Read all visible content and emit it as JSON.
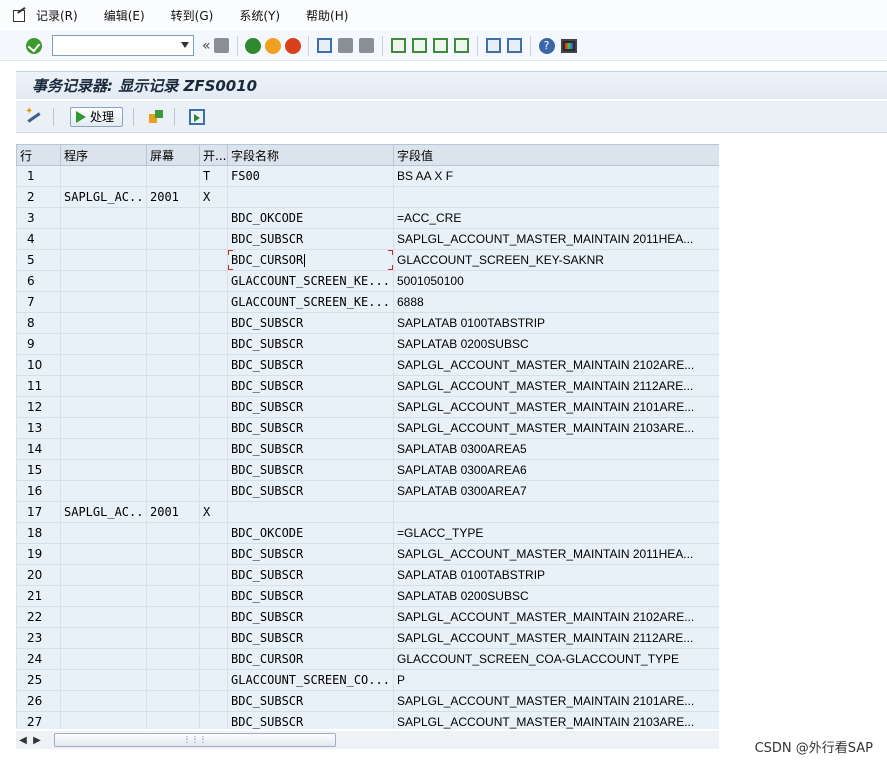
{
  "menu": {
    "items": [
      "记录(R)",
      "编辑(E)",
      "转到(G)",
      "系统(Y)",
      "帮助(H)"
    ]
  },
  "toolbar": {
    "command_field_value": "",
    "icons": [
      "enter-icon",
      "save-icon",
      "back-icon",
      "exit-icon",
      "cancel-icon",
      "print-icon",
      "find-icon",
      "find-next-icon",
      "first-page-icon",
      "previous-page-icon",
      "next-page-icon",
      "last-page-icon",
      "create-session-icon",
      "shortcut-icon",
      "help-icon",
      "customize-layout-icon"
    ]
  },
  "title": "事务记录器: 显示记录 ZFS0010",
  "app_toolbar": {
    "process_label": "处理"
  },
  "table": {
    "columns": [
      "行",
      "程序",
      "屏幕",
      "开...",
      "字段名称",
      "字段值"
    ],
    "rows": [
      {
        "n": "1",
        "prog": "",
        "screen": "",
        "start": "T",
        "field": "FS00",
        "value": "BS AA X   F"
      },
      {
        "n": "2",
        "prog": "SAPLGL_AC...",
        "screen": "2001",
        "start": "X",
        "field": "",
        "value": ""
      },
      {
        "n": "3",
        "prog": "",
        "screen": "",
        "start": "",
        "field": "BDC_OKCODE",
        "value": "=ACC_CRE"
      },
      {
        "n": "4",
        "prog": "",
        "screen": "",
        "start": "",
        "field": "BDC_SUBSCR",
        "value": "SAPLGL_ACCOUNT_MASTER_MAINTAIN          2011HEA..."
      },
      {
        "n": "5",
        "prog": "",
        "screen": "",
        "start": "",
        "field": "BDC_CURSOR",
        "value": "GLACCOUNT_SCREEN_KEY-SAKNR"
      },
      {
        "n": "6",
        "prog": "",
        "screen": "",
        "start": "",
        "field": "GLACCOUNT_SCREEN_KE...",
        "value": "5001050100"
      },
      {
        "n": "7",
        "prog": "",
        "screen": "",
        "start": "",
        "field": "GLACCOUNT_SCREEN_KE...",
        "value": "6888"
      },
      {
        "n": "8",
        "prog": "",
        "screen": "",
        "start": "",
        "field": "BDC_SUBSCR",
        "value": "SAPLATAB                                0100TABSTRIP"
      },
      {
        "n": "9",
        "prog": "",
        "screen": "",
        "start": "",
        "field": "BDC_SUBSCR",
        "value": "SAPLATAB                                0200SUBSC"
      },
      {
        "n": "10",
        "prog": "",
        "screen": "",
        "start": "",
        "field": "BDC_SUBSCR",
        "value": "SAPLGL_ACCOUNT_MASTER_MAINTAIN          2102ARE..."
      },
      {
        "n": "11",
        "prog": "",
        "screen": "",
        "start": "",
        "field": "BDC_SUBSCR",
        "value": "SAPLGL_ACCOUNT_MASTER_MAINTAIN          2112ARE..."
      },
      {
        "n": "12",
        "prog": "",
        "screen": "",
        "start": "",
        "field": "BDC_SUBSCR",
        "value": "SAPLGL_ACCOUNT_MASTER_MAINTAIN          2101ARE..."
      },
      {
        "n": "13",
        "prog": "",
        "screen": "",
        "start": "",
        "field": "BDC_SUBSCR",
        "value": "SAPLGL_ACCOUNT_MASTER_MAINTAIN          2103ARE..."
      },
      {
        "n": "14",
        "prog": "",
        "screen": "",
        "start": "",
        "field": "BDC_SUBSCR",
        "value": "SAPLATAB                                0300AREA5"
      },
      {
        "n": "15",
        "prog": "",
        "screen": "",
        "start": "",
        "field": "BDC_SUBSCR",
        "value": "SAPLATAB                                0300AREA6"
      },
      {
        "n": "16",
        "prog": "",
        "screen": "",
        "start": "",
        "field": "BDC_SUBSCR",
        "value": "SAPLATAB                                0300AREA7"
      },
      {
        "n": "17",
        "prog": "SAPLGL_AC...",
        "screen": "2001",
        "start": "X",
        "field": "",
        "value": ""
      },
      {
        "n": "18",
        "prog": "",
        "screen": "",
        "start": "",
        "field": "BDC_OKCODE",
        "value": "=GLACC_TYPE"
      },
      {
        "n": "19",
        "prog": "",
        "screen": "",
        "start": "",
        "field": "BDC_SUBSCR",
        "value": "SAPLGL_ACCOUNT_MASTER_MAINTAIN          2011HEA..."
      },
      {
        "n": "20",
        "prog": "",
        "screen": "",
        "start": "",
        "field": "BDC_SUBSCR",
        "value": "SAPLATAB                                0100TABSTRIP"
      },
      {
        "n": "21",
        "prog": "",
        "screen": "",
        "start": "",
        "field": "BDC_SUBSCR",
        "value": "SAPLATAB                                0200SUBSC"
      },
      {
        "n": "22",
        "prog": "",
        "screen": "",
        "start": "",
        "field": "BDC_SUBSCR",
        "value": "SAPLGL_ACCOUNT_MASTER_MAINTAIN          2102ARE..."
      },
      {
        "n": "23",
        "prog": "",
        "screen": "",
        "start": "",
        "field": "BDC_SUBSCR",
        "value": "SAPLGL_ACCOUNT_MASTER_MAINTAIN          2112ARE..."
      },
      {
        "n": "24",
        "prog": "",
        "screen": "",
        "start": "",
        "field": "BDC_CURSOR",
        "value": "GLACCOUNT_SCREEN_COA-GLACCOUNT_TYPE"
      },
      {
        "n": "25",
        "prog": "",
        "screen": "",
        "start": "",
        "field": "GLACCOUNT_SCREEN_CO...",
        "value": "P"
      },
      {
        "n": "26",
        "prog": "",
        "screen": "",
        "start": "",
        "field": "BDC_SUBSCR",
        "value": "SAPLGL_ACCOUNT_MASTER_MAINTAIN          2101ARE..."
      },
      {
        "n": "27",
        "prog": "",
        "screen": "",
        "start": "",
        "field": "BDC_SUBSCR",
        "value": "SAPLGL_ACCOUNT_MASTER_MAINTAIN          2103ARE..."
      }
    ]
  },
  "watermark": "CSDN @外行看SAP"
}
